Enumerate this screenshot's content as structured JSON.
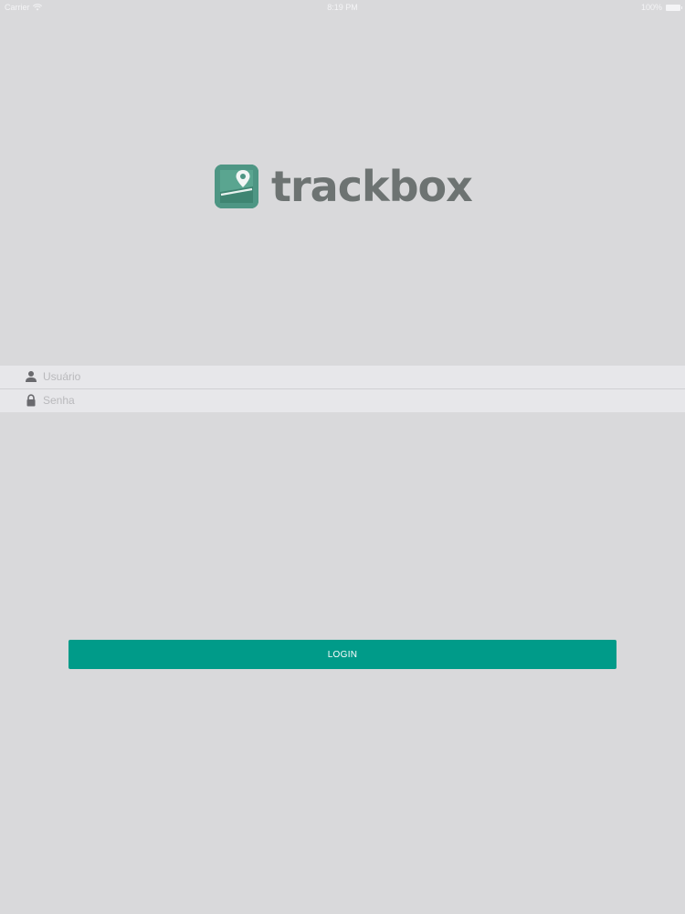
{
  "status_bar": {
    "carrier": "Carrier",
    "time": "8:19 PM",
    "battery_text": "100%",
    "battery_level": 1.0
  },
  "logo": {
    "text": "trackbox",
    "mark_color": "#4e9684",
    "text_color": "#6d7372"
  },
  "form": {
    "username": {
      "placeholder": "Usuário",
      "value": "",
      "icon": "user-icon"
    },
    "password": {
      "placeholder": "Senha",
      "value": "",
      "icon": "lock-icon"
    }
  },
  "login_button": {
    "label": "LOGIN",
    "color": "#009b89"
  }
}
